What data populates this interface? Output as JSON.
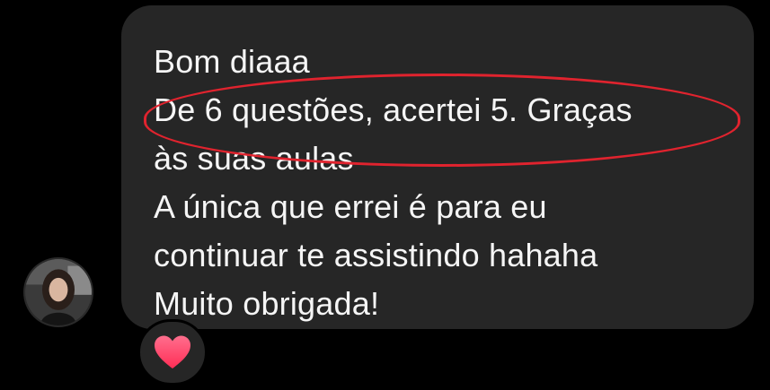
{
  "message": {
    "lines": [
      "Bom diaaa",
      "De 6 questões, acertei 5. Graças",
      "às suas aulas",
      "A única que errei é para eu",
      "continuar te assistindo hahaha",
      "Muito obrigada!"
    ]
  },
  "avatar": {
    "icon": "user-avatar-photo"
  },
  "reaction": {
    "icon": "heart-icon",
    "color": "#ff3b6b"
  },
  "highlight": {
    "color": "#e0232e"
  },
  "colors": {
    "background": "#000000",
    "bubble": "#262626",
    "text": "#f5f5f5"
  }
}
